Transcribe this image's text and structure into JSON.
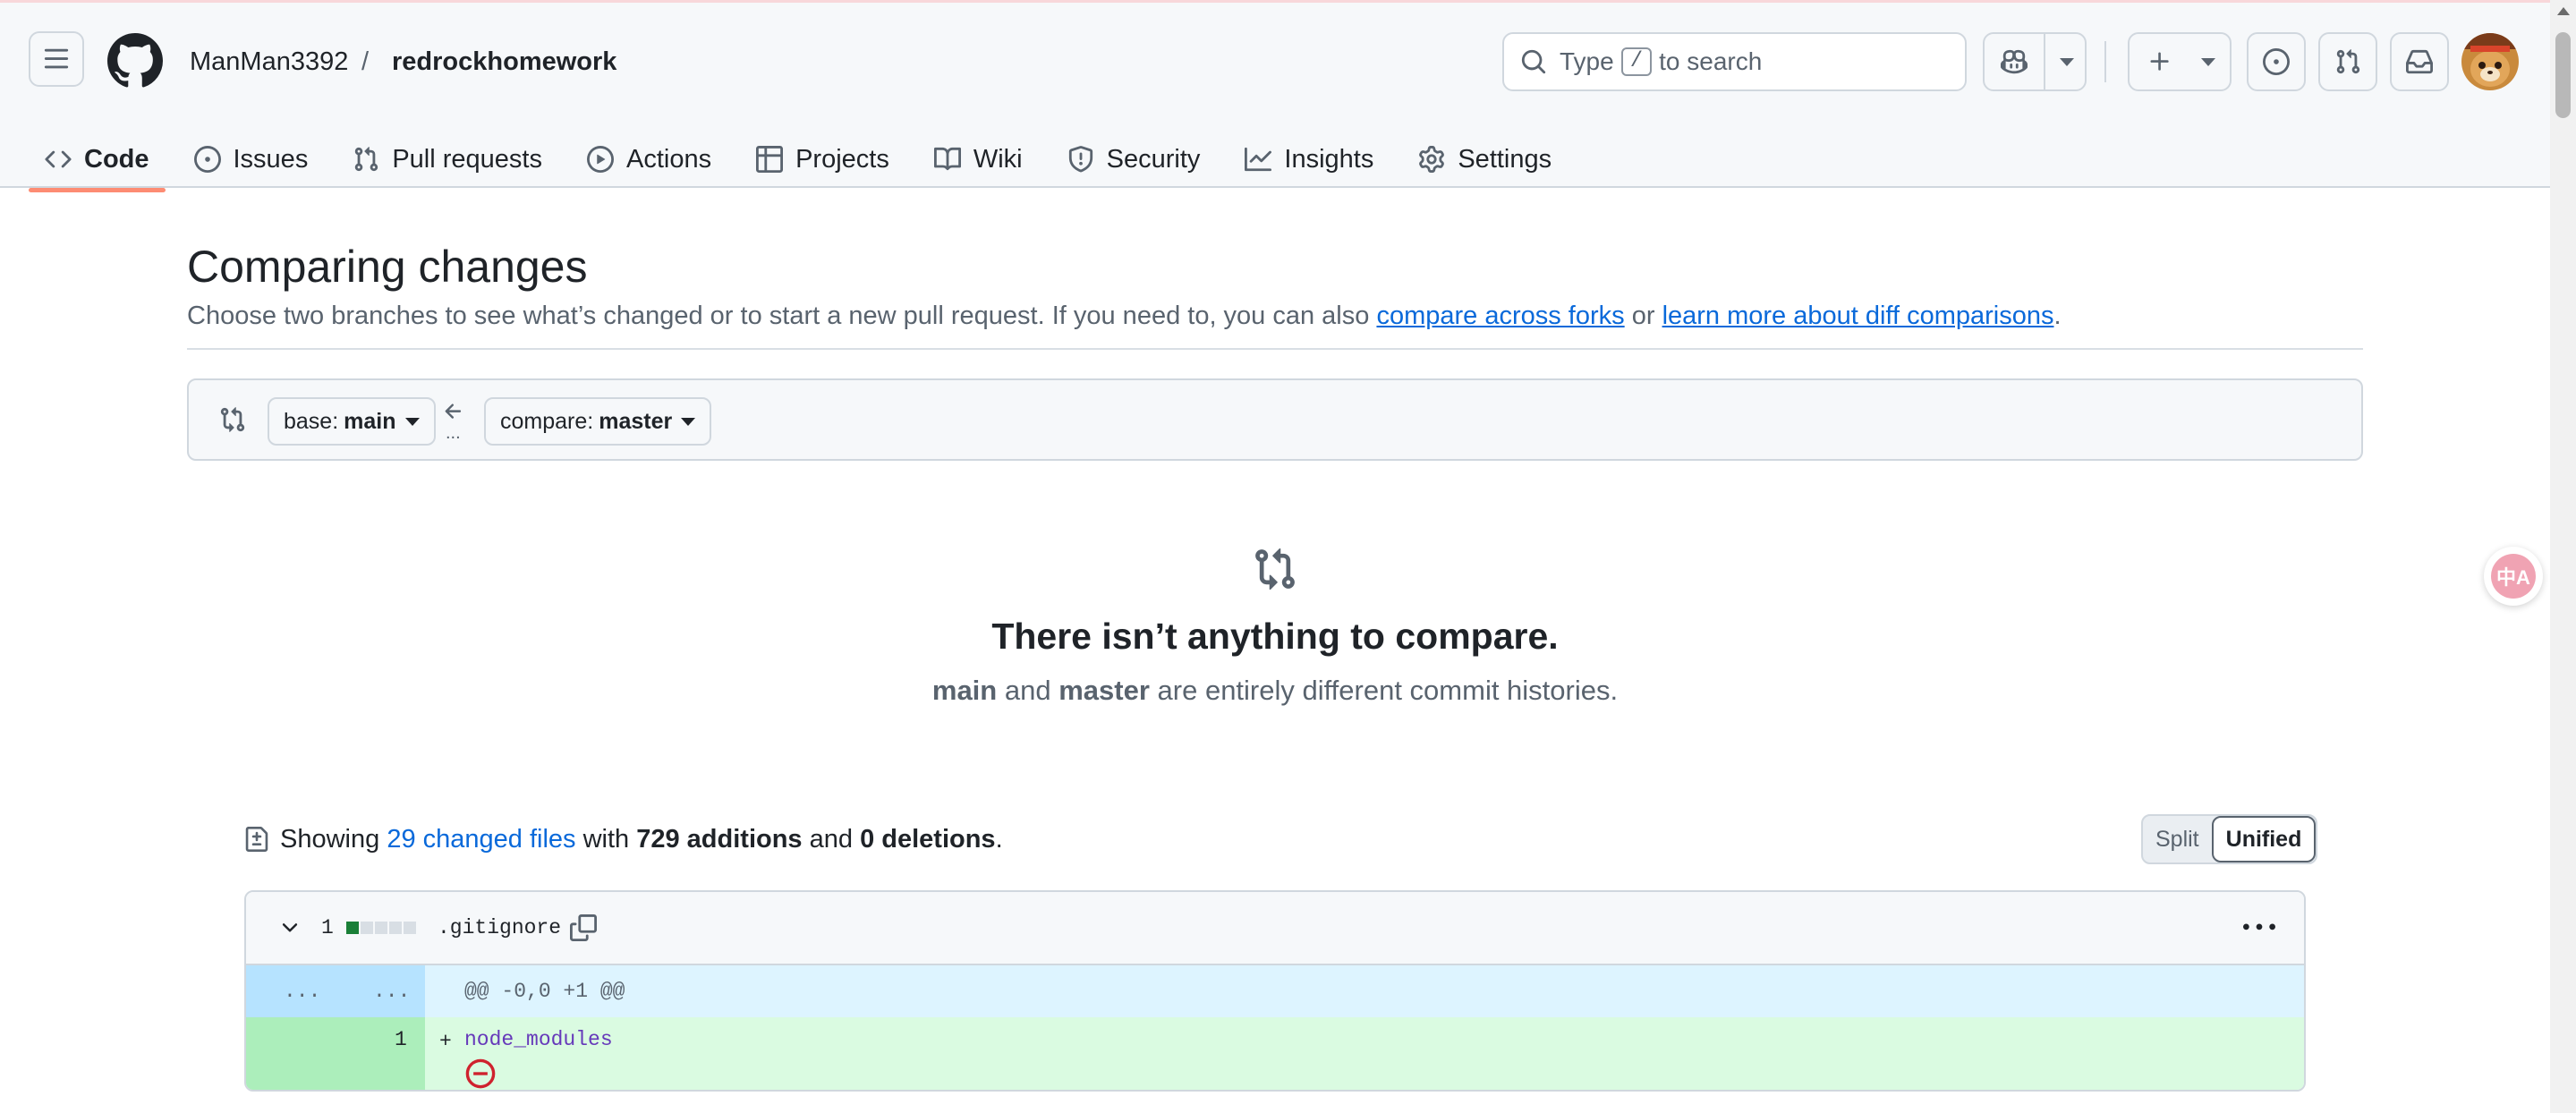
{
  "colors": {
    "accent": "#0969da",
    "tab_underline": "#fd8c73",
    "addition": "#1a7f37",
    "addition_bg": "#dafbe1",
    "hunk_bg": "#ddf4ff"
  },
  "header": {
    "owner": "ManMan3392",
    "separator": "/",
    "repo": "redrockhomework",
    "search": {
      "prefix": "Type",
      "key": "/",
      "suffix": "to search"
    }
  },
  "tabs": [
    {
      "label": "Code",
      "icon": "code-icon",
      "active": true
    },
    {
      "label": "Issues",
      "icon": "issue-opened-icon"
    },
    {
      "label": "Pull requests",
      "icon": "git-pull-request-icon"
    },
    {
      "label": "Actions",
      "icon": "play-icon"
    },
    {
      "label": "Projects",
      "icon": "table-icon"
    },
    {
      "label": "Wiki",
      "icon": "book-icon"
    },
    {
      "label": "Security",
      "icon": "shield-icon"
    },
    {
      "label": "Insights",
      "icon": "graph-icon"
    },
    {
      "label": "Settings",
      "icon": "gear-icon"
    }
  ],
  "main": {
    "title": "Comparing changes",
    "subtitle_prefix": "Choose two branches to see what’s changed or to start a new pull request. If you need to, you can also ",
    "link_forks": "compare across forks",
    "subtitle_or": " or ",
    "link_learn": "learn more about diff comparisons",
    "subtitle_end": "."
  },
  "range": {
    "base_label": "base:",
    "base_value": "main",
    "compare_label": "compare:",
    "compare_value": "master",
    "arrow_text": "..."
  },
  "blankslate": {
    "title": "There isn’t anything to compare.",
    "branch_a": "main",
    "and_text": "and",
    "branch_b": "master",
    "desc_suffix": "are entirely different commit histories."
  },
  "summary": {
    "showing": "Showing",
    "changed_files": "29 changed files",
    "with": "with",
    "additions": "729 additions",
    "and": "and",
    "deletions": "0 deletions",
    "end": "."
  },
  "view_toggle": {
    "split": "Split",
    "unified": "Unified",
    "selected": "Unified"
  },
  "file": {
    "count": "1",
    "name": ".gitignore",
    "diffstat": [
      "add",
      "neutral",
      "neutral",
      "neutral",
      "neutral"
    ],
    "hunk_left": "...",
    "hunk_right": "...",
    "hunk_header": "@@ -0,0 +1 @@",
    "line_number": "1",
    "line_marker": "+",
    "line_text": "node_modules"
  },
  "translate_fab": "中A"
}
